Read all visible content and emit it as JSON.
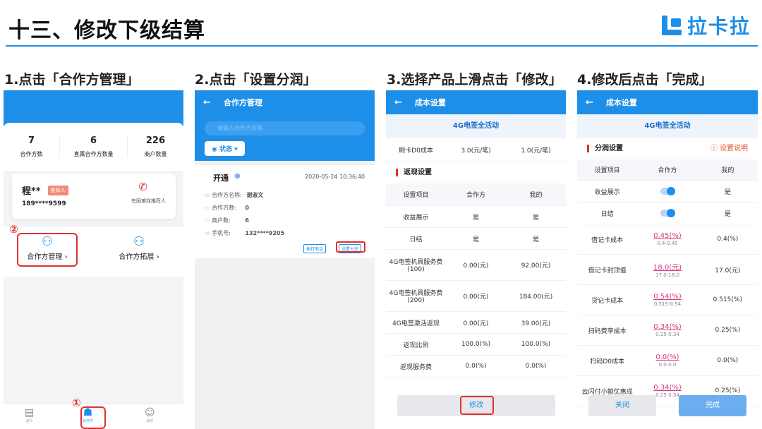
{
  "slide_title": "十三、修改下级结算",
  "brand": "拉卡拉",
  "steps": [
    "1.点击「合作方管理」",
    "2.点击「设置分润」",
    "3.选择产品上滑点击「修改」",
    "4.修改后点击「完成」"
  ],
  "p1": {
    "stats": [
      {
        "value": "7",
        "label": "合作方数"
      },
      {
        "value": "6",
        "label": "直属合作方数量"
      },
      {
        "value": "226",
        "label": "商户数量"
      }
    ],
    "referrer_name": "程**",
    "referrer_badge": "推荐人",
    "referrer_phone": "189****9599",
    "referrer_hint": "有困难找推荐人",
    "menu_manage": "合作方管理 ›",
    "menu_expand": "合作方拓展 ›",
    "marker_2": "②",
    "marker_1": "①",
    "tab_left": "首页",
    "tab_center": "合作方",
    "tab_right": "我的"
  },
  "p2": {
    "title": "合作方管理",
    "search_placeholder": "请输入合作方名称",
    "status_filter": "状态 ▾",
    "card_status": "开通",
    "card_time": "2020-05-24 10:36:40",
    "fields": [
      {
        "label": "合作方名称:",
        "value": "谢淑文"
      },
      {
        "label": "合作方数:",
        "value": "0"
      },
      {
        "label": "商户数:",
        "value": "6"
      },
      {
        "label": "手机号:",
        "value": "132****9205"
      }
    ],
    "btn_call": "拨打电话",
    "btn_profit": "设置分润"
  },
  "p3": {
    "title": "成本设置",
    "product_tab": "4G电签全活动",
    "d0_label": "刷卡D0成本",
    "d0_partner": "3.0(元/笔)",
    "d0_mine": "1.0(元/笔)",
    "section": "返现设置",
    "head": [
      "设置项目",
      "合作方",
      "我的"
    ],
    "rows": [
      [
        "收益展示",
        "是",
        "是"
      ],
      [
        "日结",
        "是",
        "是"
      ],
      [
        "4G电签机具服务费\n(100)",
        "0.00(元)",
        "92.00(元)"
      ],
      [
        "4G电签机具服务费\n(200)",
        "0.00(元)",
        "184.00(元)"
      ],
      [
        "4G电签激活返现",
        "0.00(元)",
        "39.00(元)"
      ],
      [
        "返现比例",
        "100.0(%)",
        "100.0(%)"
      ],
      [
        "返现服务费",
        "0.0(%)",
        "0.0(%)"
      ]
    ],
    "modify_btn": "修改"
  },
  "p4": {
    "title": "成本设置",
    "product_tab": "4G电签全活动",
    "section": "分润设置",
    "help": "设置说明",
    "head": [
      "设置项目",
      "合作方",
      "我的"
    ],
    "toggle_rows": [
      {
        "label": "收益展示",
        "mine": "是"
      },
      {
        "label": "日结",
        "mine": "是"
      }
    ],
    "rows": [
      {
        "label": "借记卡成本",
        "value": "0.45(%)",
        "range": "0.4-0.45",
        "mine": "0.4(%)"
      },
      {
        "label": "借记卡封顶值",
        "value": "18.0(元)",
        "range": "17.0-18.0",
        "mine": "17.0(元)"
      },
      {
        "label": "贷记卡成本",
        "value": "0.54(%)",
        "range": "0.515-0.54",
        "mine": "0.515(%)"
      },
      {
        "label": "扫码费率成本",
        "value": "0.34(%)",
        "range": "0.25-0.34",
        "mine": "0.25(%)"
      },
      {
        "label": "扫码D0成本",
        "value": "0.0(%)",
        "range": "0.0-0.0",
        "mine": "0.0(%)"
      },
      {
        "label": "云闪付小额优惠成",
        "value": "0.34(%)",
        "range": "0.25-0.34",
        "mine": "0.25(%)"
      }
    ],
    "btn_close": "关闭",
    "btn_done": "完成"
  },
  "colors": {
    "accent": "#1e8fe8",
    "highlight": "#e0302f",
    "value_pink": "#d63a7f"
  }
}
